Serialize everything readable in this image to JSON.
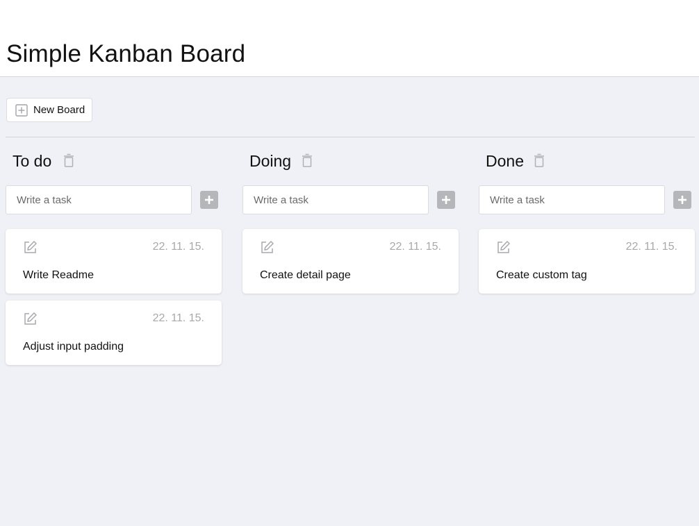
{
  "header": {
    "title": "Simple Kanban Board"
  },
  "toolbar": {
    "new_board_label": "New Board"
  },
  "columns": [
    {
      "title": "To do",
      "input_placeholder": "Write a task",
      "cards": [
        {
          "date": "22. 11. 15.",
          "text": "Write Readme"
        },
        {
          "date": "22. 11. 15.",
          "text": "Adjust input padding"
        }
      ]
    },
    {
      "title": "Doing",
      "input_placeholder": "Write a task",
      "cards": [
        {
          "date": "22. 11. 15.",
          "text": "Create detail page"
        }
      ]
    },
    {
      "title": "Done",
      "input_placeholder": "Write a task",
      "cards": [
        {
          "date": "22. 11. 15.",
          "text": "Create custom tag"
        }
      ]
    }
  ],
  "colors": {
    "background": "#eff1f6",
    "card": "#ffffff",
    "muted": "#a8a8ab",
    "add_button": "#b5b6ba"
  },
  "icons": [
    "plus-square-icon",
    "trash-icon",
    "plus-icon",
    "edit-icon"
  ]
}
